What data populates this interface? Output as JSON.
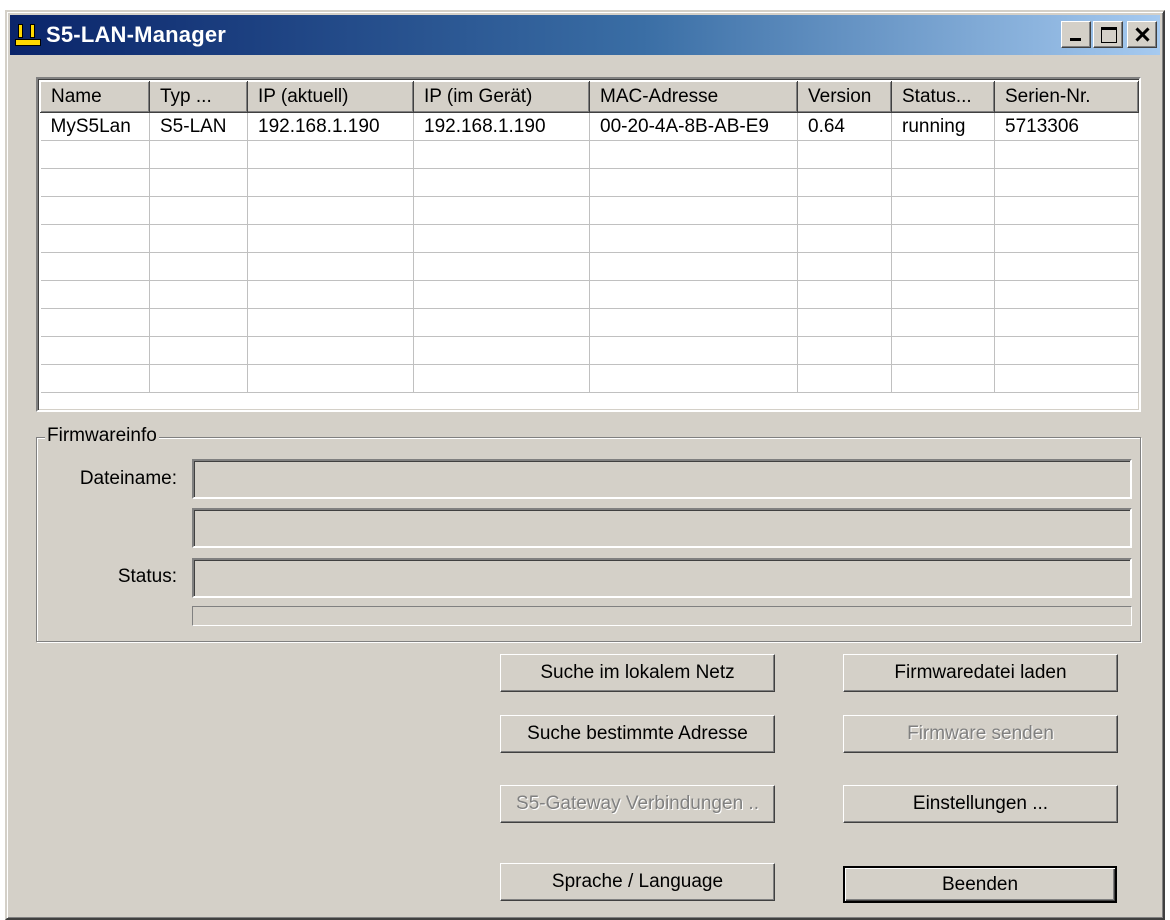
{
  "window": {
    "title": "S5-LAN-Manager",
    "controls": {
      "minimize": "minimize-icon",
      "maximize": "maximize-icon",
      "close": "close-icon"
    }
  },
  "list": {
    "columns": [
      "Name",
      "Typ ...",
      "IP (aktuell)",
      "IP (im Gerät)",
      "MAC-Adresse",
      "Version",
      "Status...",
      "Serien-Nr."
    ],
    "rows": [
      {
        "name": "MyS5Lan",
        "typ": "S5-LAN",
        "ip_aktuell": "192.168.1.190",
        "ip_geraet": "192.168.1.190",
        "mac": "00-20-4A-8B-AB-E9",
        "version": "0.64",
        "status": "running",
        "serial": "5713306"
      }
    ]
  },
  "firmwareinfo": {
    "group_label": "Firmwareinfo",
    "dateiname_label": "Dateiname:",
    "status_label": "Status:",
    "dateiname_value": "",
    "extra_value": "",
    "status_value": "",
    "progress": 0
  },
  "buttons": {
    "search_local": "Suche im lokalem Netz",
    "load_firmware": "Firmwaredatei laden",
    "search_address": "Suche bestimmte Adresse",
    "send_firmware": "Firmware senden",
    "gateway_connections": "S5-Gateway Verbindungen ..",
    "settings": "Einstellungen ...",
    "language": "Sprache / Language",
    "exit": "Beenden"
  },
  "colors": {
    "face": "#d4d0c8",
    "title_start": "#0a246a",
    "title_end": "#a6caf0",
    "disabled_text": "#808080"
  }
}
